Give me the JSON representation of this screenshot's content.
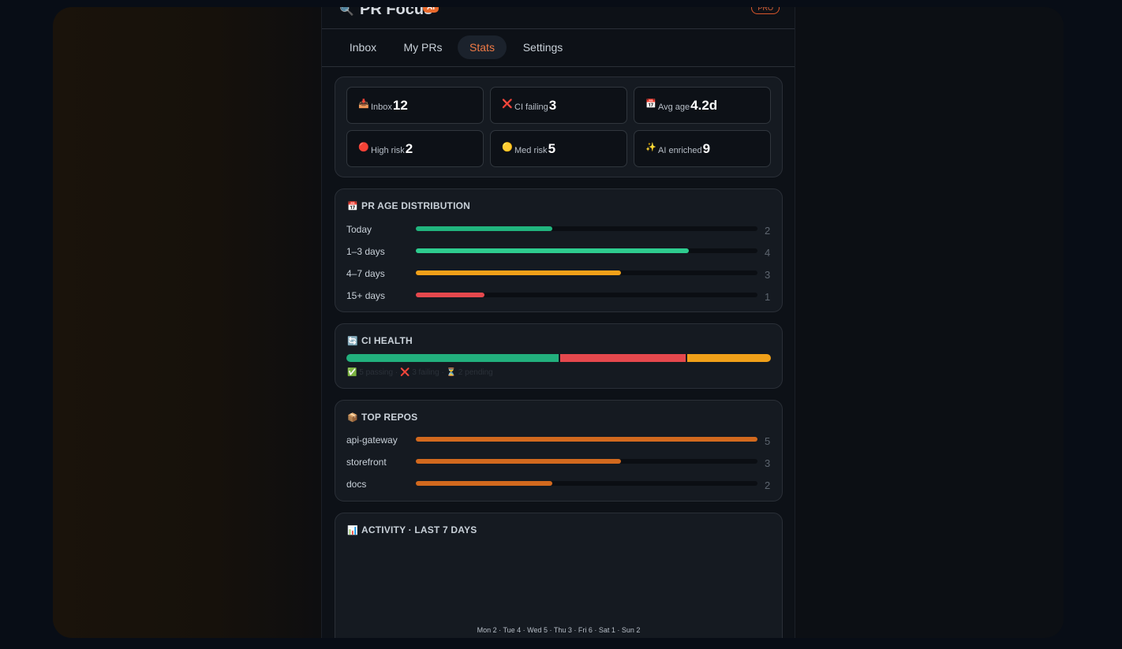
{
  "header": {
    "app_title": "PR Focus",
    "ai_badge": "AI",
    "pro_badge": "PRO",
    "logo_icon": "🔍"
  },
  "tabs": [
    {
      "label": "Inbox",
      "active": false
    },
    {
      "label": "My PRs",
      "active": false
    },
    {
      "label": "Stats",
      "active": true
    },
    {
      "label": "Settings",
      "active": false
    }
  ],
  "stats": [
    {
      "icon": "📥",
      "label": "Inbox",
      "value": "12"
    },
    {
      "icon": "❌",
      "label": "CI failing",
      "value": "3"
    },
    {
      "icon": "📅",
      "label": "Avg age",
      "value": "4.2d"
    },
    {
      "icon": "🔴",
      "label": "High risk",
      "value": "2"
    },
    {
      "icon": "🟡",
      "label": "Med risk",
      "value": "5"
    },
    {
      "icon": "✨",
      "label": "AI enriched",
      "value": "9"
    }
  ],
  "age_distribution": {
    "title": "PR AGE DISTRIBUTION",
    "icon": "📅",
    "max": 4,
    "rows": [
      {
        "label": "Today",
        "count": 2,
        "color": "#21b57e"
      },
      {
        "label": "1–3 days",
        "count": 4,
        "color": "#2ecc8f"
      },
      {
        "label": "4–7 days",
        "count": 3,
        "color": "#f0a019"
      },
      {
        "label": "15+ days",
        "count": 1,
        "color": "#e5484d"
      }
    ]
  },
  "ci_health": {
    "title": "CI HEALTH",
    "icon": "🔄",
    "segments": [
      {
        "name": "passing",
        "count": 5,
        "color": "#22b07d"
      },
      {
        "name": "failing",
        "count": 3,
        "color": "#e5484d"
      },
      {
        "name": "pending",
        "count": 2,
        "color": "#f0a019"
      }
    ],
    "legend": {
      "passing_icon": "✅",
      "passing": "5 passing",
      "failing_icon": "❌",
      "failing": "3 failing",
      "pending_icon": "⏳",
      "pending": "2 pending",
      "separator": "·"
    }
  },
  "top_repos": {
    "title": "TOP REPOS",
    "icon": "📦",
    "max": 5,
    "color": "#d2691e",
    "rows": [
      {
        "label": "api-gateway",
        "count": 5
      },
      {
        "label": "storefront",
        "count": 3
      },
      {
        "label": "docs",
        "count": 2
      }
    ]
  },
  "activity": {
    "title": "ACTIVITY · LAST 7 DAYS",
    "icon": "📊",
    "days_line": "Mon 2 · Tue 4 · Wed 5 · Thu 3 · Fri 6 · Sat 1 · Sun 2"
  }
}
